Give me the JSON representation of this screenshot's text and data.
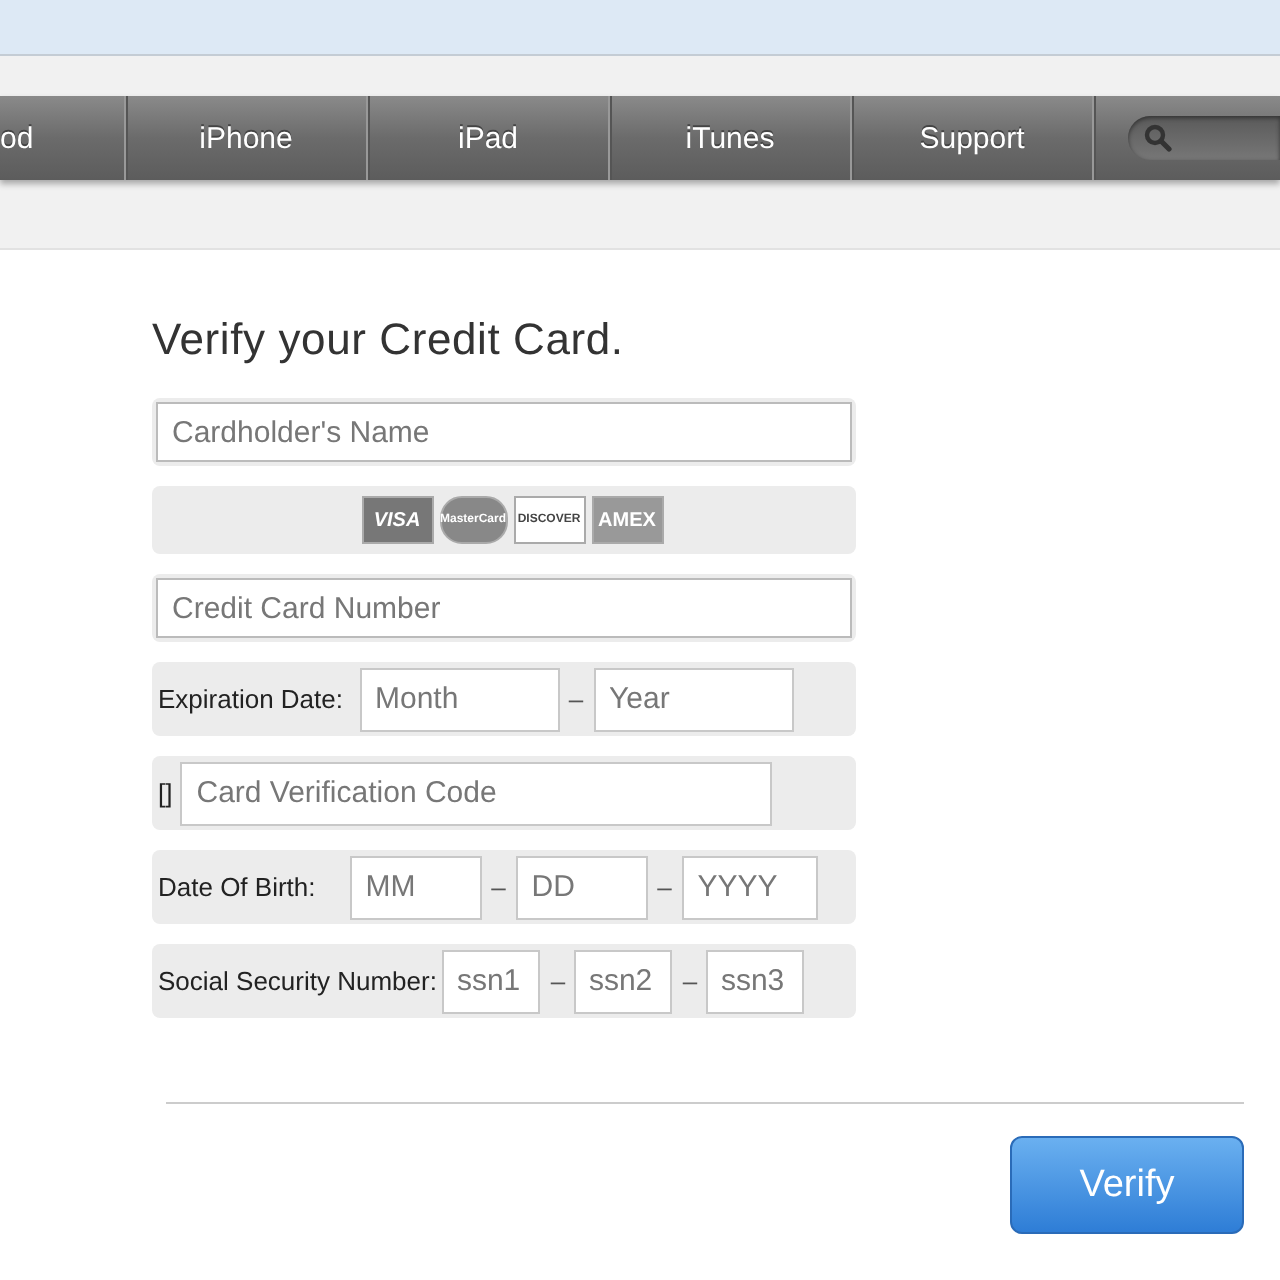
{
  "nav": {
    "items": [
      {
        "label": "od"
      },
      {
        "label": "iPhone"
      },
      {
        "label": "iPad"
      },
      {
        "label": "iTunes"
      },
      {
        "label": "Support"
      }
    ]
  },
  "form": {
    "title": "Verify your Credit Card.",
    "rows": [
      {
        "kind": "field",
        "placeholder": "Cardholder's Name"
      },
      {
        "kind": "cards",
        "cards": [
          "VISA",
          "MasterCard",
          "DISCOVER",
          "AMEX"
        ]
      },
      {
        "kind": "field",
        "placeholder": "Credit Card Number"
      },
      {
        "kind": "expiry",
        "label": "Expiration Date:",
        "parts": [
          {
            "kind": "input",
            "placeholder": "Month"
          },
          {
            "kind": "dash",
            "text": "–"
          },
          {
            "kind": "input",
            "placeholder": "Year"
          }
        ]
      },
      {
        "kind": "cvv",
        "label": "[]",
        "placeholder": "Card Verification Code"
      },
      {
        "kind": "birth",
        "label": "Date Of Birth:",
        "parts": [
          {
            "kind": "input",
            "placeholder": "MM"
          },
          {
            "kind": "dash",
            "text": "–"
          },
          {
            "kind": "input",
            "placeholder": "DD"
          },
          {
            "kind": "dash",
            "text": "–"
          },
          {
            "kind": "input",
            "placeholder": "YYYY"
          }
        ]
      },
      {
        "kind": "ssn",
        "label": "Social Security Number:",
        "parts": [
          {
            "kind": "input",
            "placeholder": "ssn1"
          },
          {
            "kind": "dash",
            "text": "–"
          },
          {
            "kind": "input",
            "placeholder": "ssn2"
          },
          {
            "kind": "dash",
            "text": "–"
          },
          {
            "kind": "input",
            "placeholder": "ssn3"
          }
        ]
      }
    ],
    "button": "Verify"
  }
}
